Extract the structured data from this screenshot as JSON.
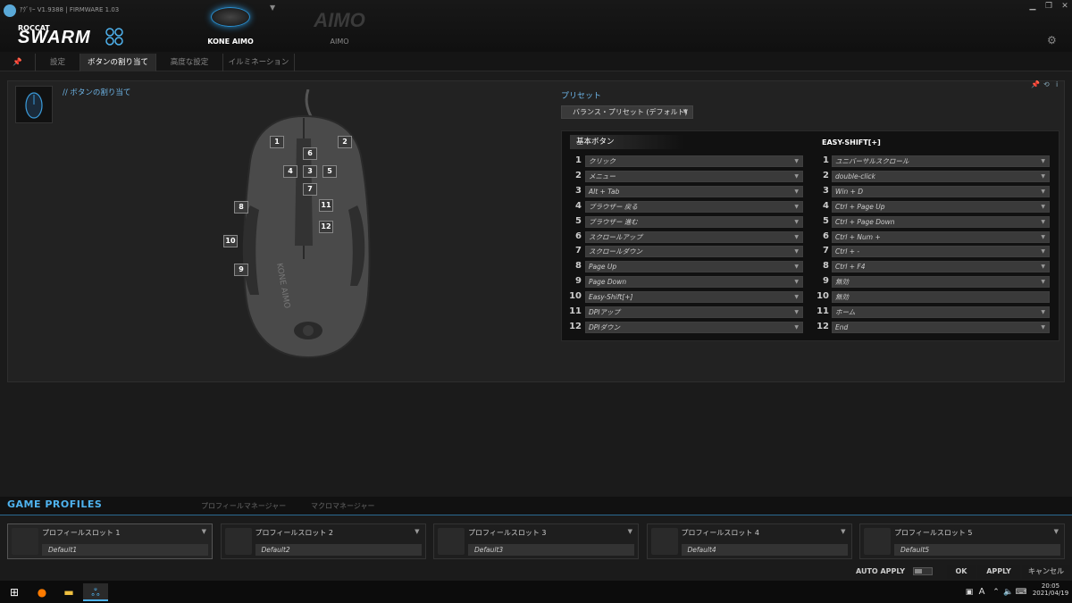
{
  "app": {
    "version": "ｱｸﾞﾘｰ V1.9388 | FIRMWARE 1.03",
    "logo_small": "ROCCAT",
    "logo_big": "SWARM"
  },
  "devices": [
    {
      "name": "KONE AIMO"
    },
    {
      "name": "AIMO",
      "display": "AIMO"
    }
  ],
  "tabs": [
    {
      "label": "設定"
    },
    {
      "label": "ボタンの割り当て"
    },
    {
      "label": "高度な設定"
    },
    {
      "label": "イルミネーション"
    }
  ],
  "section_title": "// ボタンの割り当て",
  "preset": {
    "label": "プリセット",
    "value": "バランス・プリセット (デフォルト)"
  },
  "table": {
    "basic_header": "基本ボタン",
    "shift_header": "EASY-SHIFT[+]",
    "rows": [
      {
        "n": "1",
        "basic": "クリック",
        "shift": "ユニバーサルスクロール"
      },
      {
        "n": "2",
        "basic": "メニュー",
        "shift": "double-click"
      },
      {
        "n": "3",
        "basic": "Alt + Tab",
        "shift": "Win + D"
      },
      {
        "n": "4",
        "basic": "ブラウザー 戻る",
        "shift": "Ctrl + Page Up"
      },
      {
        "n": "5",
        "basic": "ブラウザー 進む",
        "shift": "Ctrl + Page Down"
      },
      {
        "n": "6",
        "basic": "スクロールアップ",
        "shift": "Ctrl + Num +"
      },
      {
        "n": "7",
        "basic": "スクロールダウン",
        "shift": "Ctrl + -"
      },
      {
        "n": "8",
        "basic": "Page Up",
        "shift": "Ctrl + F4"
      },
      {
        "n": "9",
        "basic": "Page Down",
        "shift": "無効"
      },
      {
        "n": "10",
        "basic": "Easy-Shift[+]",
        "shift": "無効"
      },
      {
        "n": "11",
        "basic": "DPIアップ",
        "shift": "ホーム"
      },
      {
        "n": "12",
        "basic": "DPIダウン",
        "shift": "End"
      }
    ]
  },
  "mouse_label": "KONE AIMO",
  "callouts": [
    "1",
    "2",
    "6",
    "4",
    "3",
    "5",
    "7",
    "11",
    "8",
    "12",
    "10",
    "9"
  ],
  "profiles": {
    "title": "GAME PROFILES",
    "tabs": [
      "プロフィールマネージャー",
      "マクロマネージャー"
    ],
    "slots": [
      {
        "name": "プロフィールスロット 1",
        "value": "Default1"
      },
      {
        "name": "プロフィールスロット 2",
        "value": "Default2"
      },
      {
        "name": "プロフィールスロット 3",
        "value": "Default3"
      },
      {
        "name": "プロフィールスロット 4",
        "value": "Default4"
      },
      {
        "name": "プロフィールスロット 5",
        "value": "Default5"
      }
    ]
  },
  "footer": {
    "auto_apply": "AUTO APPLY",
    "ok": "OK",
    "apply": "APPLY",
    "cancel": "キャンセル"
  },
  "taskbar": {
    "time": "20:05",
    "date": "2021/04/19",
    "ime": "A"
  },
  "colors": {
    "accent": "#4fb3ef",
    "background": "#1b1b1b"
  }
}
